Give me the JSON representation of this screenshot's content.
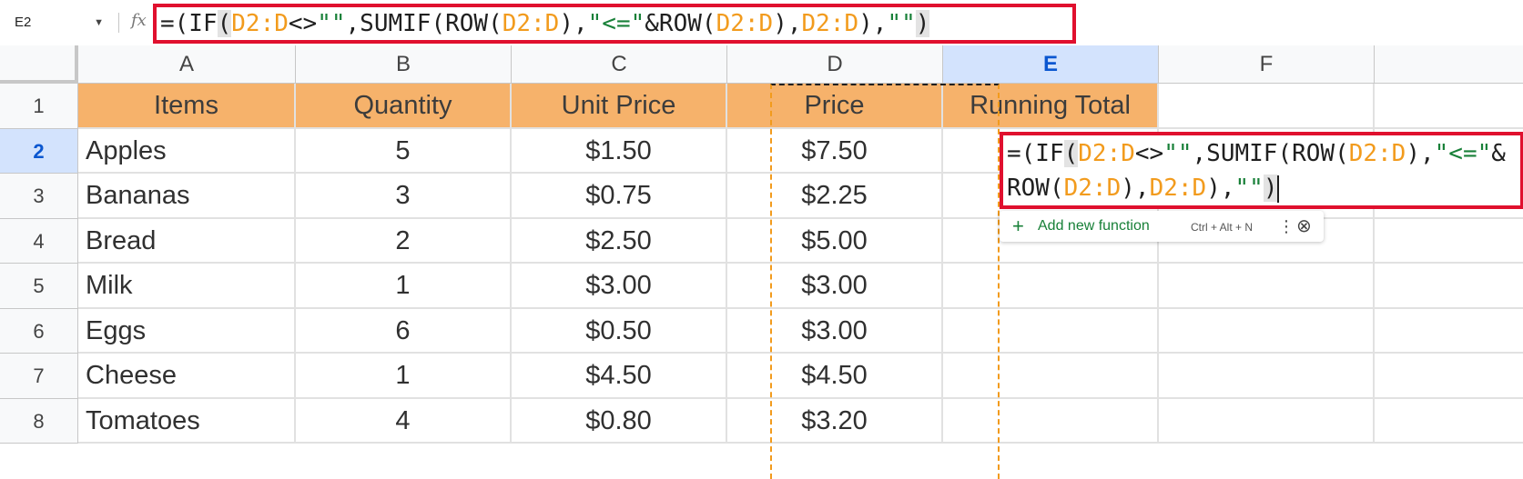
{
  "name_box": {
    "value": "E2"
  },
  "formula_bar": {
    "fx_label": "fx",
    "tokens": [
      {
        "t": "=(IF",
        "c": "plain"
      },
      {
        "t": "(",
        "c": "hl"
      },
      {
        "t": "D2:D",
        "c": "ref"
      },
      {
        "t": "<>",
        "c": "plain"
      },
      {
        "t": "\"\"",
        "c": "str"
      },
      {
        "t": ",SUMIF(ROW(",
        "c": "plain"
      },
      {
        "t": "D2:D",
        "c": "ref"
      },
      {
        "t": "),",
        "c": "plain"
      },
      {
        "t": "\"<=\"",
        "c": "str"
      },
      {
        "t": "&ROW(",
        "c": "plain"
      },
      {
        "t": "D2:D",
        "c": "ref"
      },
      {
        "t": "),",
        "c": "plain"
      },
      {
        "t": "D2:D",
        "c": "ref"
      },
      {
        "t": "),",
        "c": "plain"
      },
      {
        "t": "\"\"",
        "c": "str"
      },
      {
        "t": ")",
        "c": "hl"
      }
    ]
  },
  "columns": [
    "A",
    "B",
    "C",
    "D",
    "E",
    "F"
  ],
  "selected_column": "E",
  "rows": [
    "1",
    "2",
    "3",
    "4",
    "5",
    "6",
    "7",
    "8"
  ],
  "selected_row": "2",
  "table": {
    "headers": [
      "Items",
      "Quantity",
      "Unit Price",
      "Price",
      "Running Total"
    ],
    "data": [
      [
        "Apples",
        "5",
        "$1.50",
        "$7.50"
      ],
      [
        "Bananas",
        "3",
        "$0.75",
        "$2.25"
      ],
      [
        "Bread",
        "2",
        "$2.50",
        "$5.00"
      ],
      [
        "Milk",
        "1",
        "$3.00",
        "$3.00"
      ],
      [
        "Eggs",
        "6",
        "$0.50",
        "$3.00"
      ],
      [
        "Cheese",
        "1",
        "$4.50",
        "$4.50"
      ],
      [
        "Tomatoes",
        "4",
        "$0.80",
        "$3.20"
      ]
    ]
  },
  "autocomplete": {
    "add_function_label": "Add new function",
    "shortcut": "Ctrl + Alt + N",
    "plus_icon": "plus-icon",
    "more_icon": "more-vert-icon",
    "close_icon": "close-circle-icon"
  },
  "colors": {
    "header_fill": "#f6b26b",
    "ref_color": "#f29b1d",
    "string_color": "#188038",
    "highlight_border": "#e0102e",
    "selected_header": "#d3e3fd"
  }
}
